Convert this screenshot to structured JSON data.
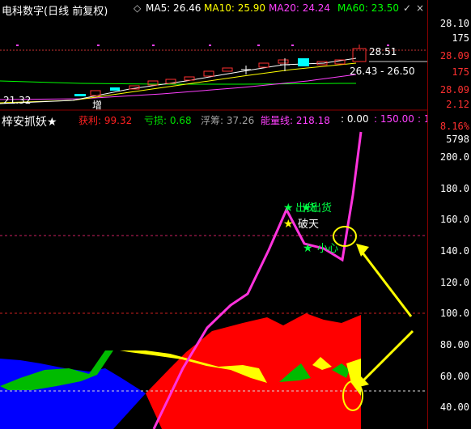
{
  "top": {
    "title": "电科数字(日线 前复权)",
    "ma": [
      {
        "label": "MA5: 26.46",
        "color": "#ffffff"
      },
      {
        "label": "MA10: 25.90",
        "color": "#ffff00"
      },
      {
        "label": "MA20: 24.24",
        "color": "#ff40ff"
      },
      {
        "label": "MA60: 23.50",
        "color": "#00ff00"
      }
    ],
    "axis": [
      "28.10",
      "175",
      "28.09",
      "175",
      "28.09",
      "2.12"
    ],
    "hi_label": "28.51",
    "range_label": "26.43 - 26.50",
    "lo_label": "21.32",
    "vol_tag": "增"
  },
  "bottom": {
    "title": "梓安抓妖★",
    "vals": [
      {
        "label": "获利: 99.32",
        "color": "#ff2020"
      },
      {
        "label": "亏损: 0.68",
        "color": "#00e000"
      },
      {
        "label": "浮筹: 37.26",
        "color": "#a0a0a0"
      },
      {
        "label": "能量线: 218.18",
        "color": "#ff40ff"
      },
      {
        "label": ": 0.00",
        "color": "#ffffff"
      },
      {
        "label": ": 150.00",
        "color": "#ff40ff"
      },
      {
        "label": ": 1",
        "color": "#ff40ff"
      }
    ],
    "pct": "8.16%",
    "volume": "5798",
    "axis": [
      "200.0",
      "180.0",
      "160.0",
      "140.0",
      "120.0",
      "100.0",
      "80.00",
      "60.00",
      "40.00"
    ],
    "signals": {
      "chu": "出货",
      "huo": "出货",
      "potian": "破天",
      "xiaoxin": "小心"
    }
  },
  "colors": {
    "profit": "#ff0000",
    "loss": "#0000ff",
    "energy": "#ff33dd",
    "yellow": "#ffff00",
    "green": "#00cc00"
  }
}
